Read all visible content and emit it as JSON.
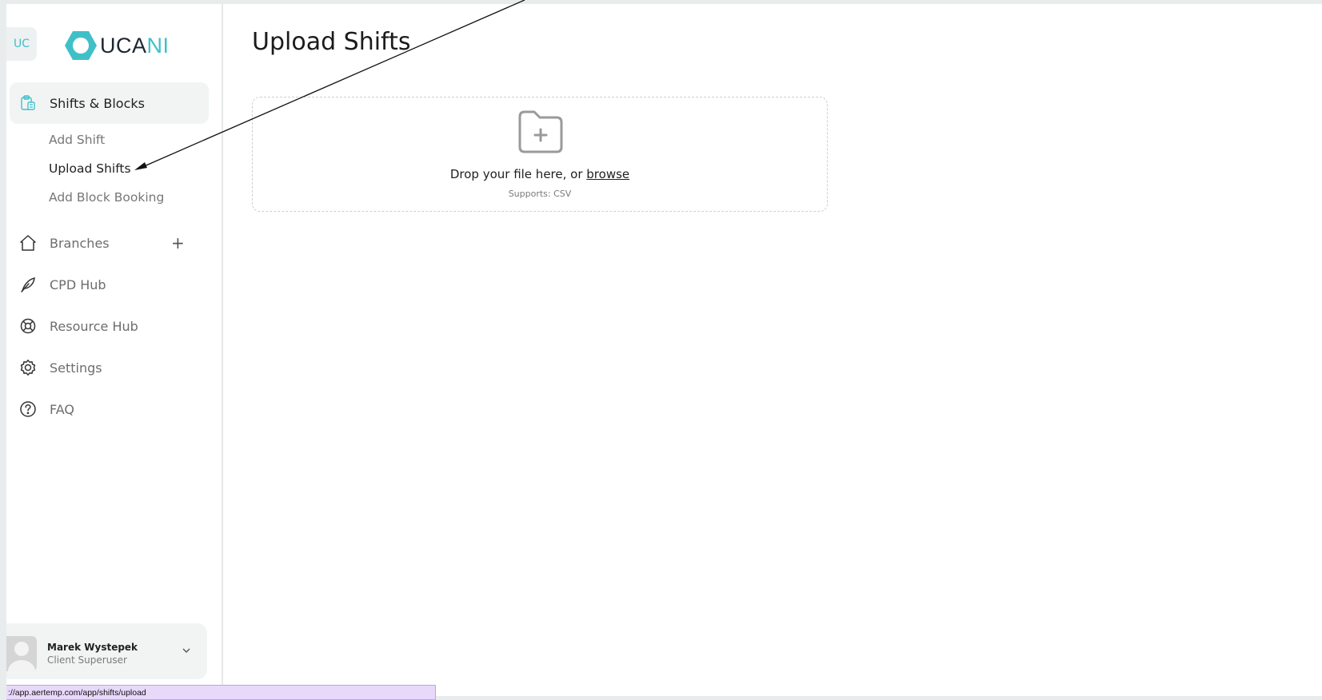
{
  "org_badge": "UC",
  "logo": {
    "dark": "UCA",
    "accent": "NI"
  },
  "colors": {
    "accent": "#3fc0c9",
    "active_bg": "#f2f4f4",
    "status_bar_bg": "#e8d9fb"
  },
  "sidebar": {
    "section": {
      "label": "Shifts & Blocks",
      "icon": "clipboard-icon"
    },
    "sub_items": [
      {
        "label": "Add Shift"
      },
      {
        "label": "Upload Shifts"
      },
      {
        "label": "Add Block Booking"
      }
    ],
    "items": [
      {
        "label": "Branches",
        "icon": "home-icon"
      },
      {
        "label": "CPD Hub",
        "icon": "feather-icon"
      },
      {
        "label": "Resource Hub",
        "icon": "lifebuoy-icon"
      },
      {
        "label": "Settings",
        "icon": "gear-icon"
      },
      {
        "label": "FAQ",
        "icon": "question-circle-icon"
      }
    ],
    "branches_add": "+"
  },
  "user": {
    "name": "Marek Wystepek",
    "role": "Client Superuser"
  },
  "main": {
    "title": "Upload Shifts",
    "dropzone": {
      "text": "Drop your file here, or",
      "browse": "browse",
      "supports": "Supports: CSV"
    }
  },
  "status_url": "://app.aertemp.com/app/shifts/upload"
}
